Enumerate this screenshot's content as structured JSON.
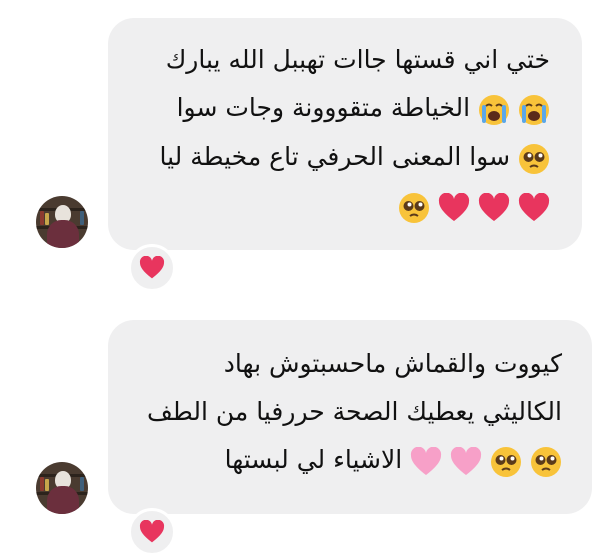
{
  "messages": [
    {
      "lines": [
        "ختي اني قستها جاات تهببل الله يبارك",
        "الخياطة متقووونة وجات سوا",
        "سوا المعنى الحرفي تاع مخيطة ليا"
      ],
      "line1_emoji": [
        "crying-face",
        "crying-face"
      ],
      "line2_emoji": [
        "pleading-face"
      ],
      "line3_emoji": [
        "pleading-face",
        "red-heart",
        "red-heart",
        "red-heart"
      ],
      "reaction": "red-heart"
    },
    {
      "lines": [
        "كيووت والقماش ماحسبتوش بهاد",
        "الكاليثي يعطيك الصحة حررفيا من الطف",
        "الاشياء لي لبستها"
      ],
      "line2_emoji": [
        "pleading-face",
        "pleading-face",
        "pink-heart",
        "pink-heart"
      ],
      "reaction": "red-heart"
    }
  ],
  "colors": {
    "bubble": "#efeff0",
    "red_heart": "#e8355e",
    "pink_heart": "#f7a0c8",
    "text": "#111111"
  }
}
